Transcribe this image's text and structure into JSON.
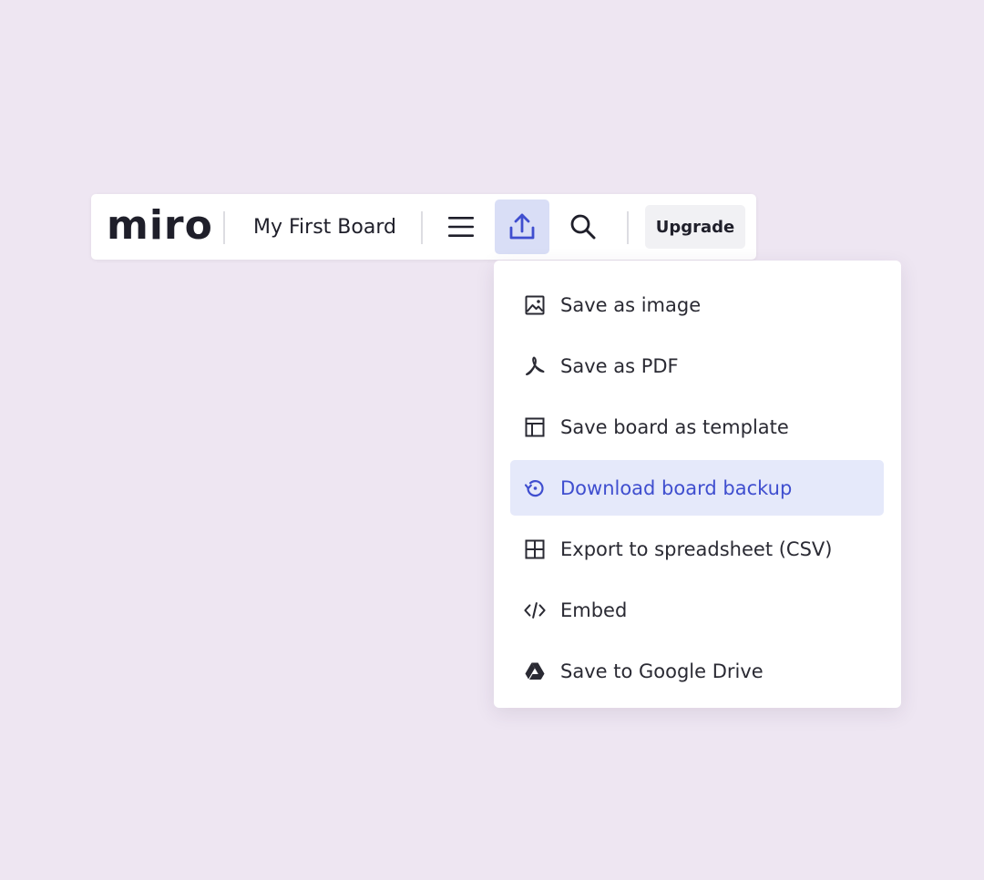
{
  "toolbar": {
    "logo_text": "miro",
    "board_title": "My First Board",
    "menu_icon": "hamburger-menu-icon",
    "export_icon": "upload-export-icon",
    "search_icon": "search-icon",
    "upgrade_label": "Upgrade"
  },
  "export_menu": {
    "items": [
      {
        "label": "Save as image",
        "icon": "image-icon"
      },
      {
        "label": "Save as PDF",
        "icon": "pdf-icon"
      },
      {
        "label": "Save board as template",
        "icon": "template-icon"
      },
      {
        "label": "Download board backup",
        "icon": "backup-restore-icon",
        "highlighted": true
      },
      {
        "label": "Export to spreadsheet (CSV)",
        "icon": "table-grid-icon"
      },
      {
        "label": "Embed",
        "icon": "code-embed-icon"
      },
      {
        "label": "Save to Google Drive",
        "icon": "google-drive-icon"
      }
    ]
  },
  "colors": {
    "background": "#EEE6F2",
    "accent": "#3F4ECF",
    "active_button_bg": "#D9DEF6",
    "highlight_bg": "#E5E9FA",
    "text": "#1F1F2A"
  }
}
